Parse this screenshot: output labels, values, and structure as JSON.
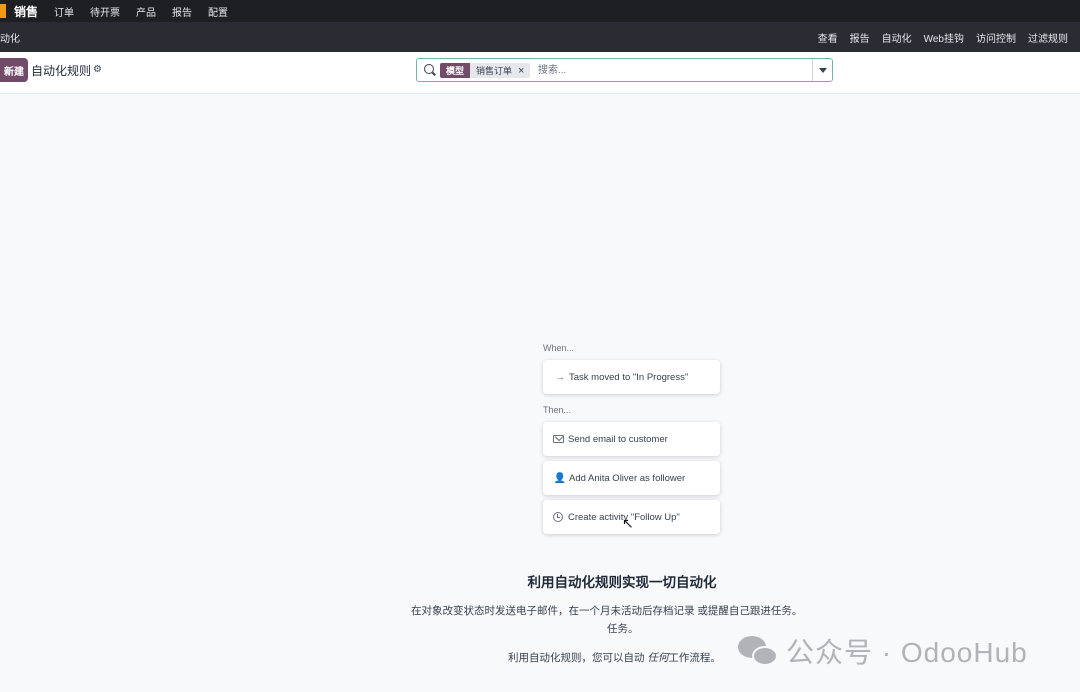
{
  "app": {
    "name": "销售",
    "menu": [
      "订单",
      "待开票",
      "产品",
      "报告",
      "配置"
    ]
  },
  "subbar": {
    "breadcrumb": "动化",
    "menu": [
      "查看",
      "报告",
      "自动化",
      "Web挂钩",
      "访问控制",
      "过滤规则"
    ]
  },
  "control": {
    "new_label": "新建",
    "title": "自动化规则",
    "search": {
      "facet_label": "模型",
      "facet_value": "销售订单",
      "placeholder": "搜索..."
    }
  },
  "illustration": {
    "when_label": "When...",
    "then_label": "Then...",
    "trigger": "Task moved to \"In Progress\"",
    "actions": [
      "Send email to customer",
      "Add Anita Oliver as follower",
      "Create activity \"Follow Up\""
    ]
  },
  "empty_state": {
    "title": "利用自动化规则实现一切自动化",
    "line1": "在对象改变状态时发送电子邮件，在一个月未活动后存档记录 或提醒自己跟进任务。",
    "line2": "任务。",
    "line3_prefix": "利用自动化规则，您可以自动 ",
    "line3_emph": "任何",
    "line3_suffix": "工作流程。"
  },
  "watermark": {
    "text": "公众号 · OdooHub"
  },
  "colors": {
    "brand": "#714b67",
    "navbar": "#1e1f23",
    "subbar": "#2b2c33",
    "logo": "#f29a17"
  }
}
